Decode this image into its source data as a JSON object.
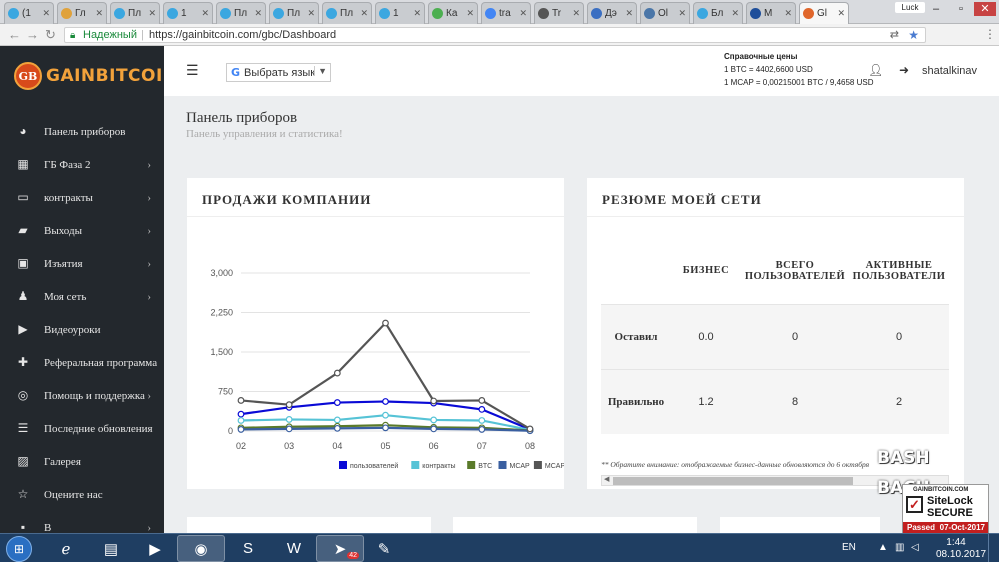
{
  "browser": {
    "tabs": [
      {
        "label": "(1",
        "color": "#3ba7e0"
      },
      {
        "label": "Гл",
        "color": "#e0a23b"
      },
      {
        "label": "Пл",
        "color": "#3ba7e0"
      },
      {
        "label": "1",
        "color": "#3ba7e0"
      },
      {
        "label": "Пл",
        "color": "#3ba7e0"
      },
      {
        "label": "Пл",
        "color": "#3ba7e0"
      },
      {
        "label": "Пл",
        "color": "#3ba7e0"
      },
      {
        "label": "1",
        "color": "#3ba7e0"
      },
      {
        "label": "Ка",
        "color": "#4caf50"
      },
      {
        "label": "tra",
        "color": "#4285f4"
      },
      {
        "label": "Tr",
        "color": "#555555"
      },
      {
        "label": "Дэ",
        "color": "#3b6fc2"
      },
      {
        "label": "Ol",
        "color": "#4a76a8"
      },
      {
        "label": "Бл",
        "color": "#3ba7e0"
      },
      {
        "label": "M",
        "color": "#1e4e9a"
      },
      {
        "label": "Gl",
        "color": "#e0662b"
      }
    ],
    "window_user": "Luck",
    "secure_label": "Надежный",
    "url": "https://gainbitcoin.com/gbc/Dashboard"
  },
  "sidebar": {
    "logo_badge": "GB",
    "logo_text": "GAINBITCOIN",
    "items": [
      {
        "label": "Панель приборов",
        "icon": "dashboard-icon",
        "glyph": "◕",
        "chevron": false
      },
      {
        "label": "ГБ Фаза 2",
        "icon": "grid-icon",
        "glyph": "▦",
        "chevron": true
      },
      {
        "label": "контракты",
        "icon": "contract-icon",
        "glyph": "▭",
        "chevron": true
      },
      {
        "label": "Выходы",
        "icon": "briefcase-icon",
        "glyph": "▰",
        "chevron": true
      },
      {
        "label": "Изъятия",
        "icon": "money-icon",
        "glyph": "▣",
        "chevron": true
      },
      {
        "label": "Моя сеть",
        "icon": "users-icon",
        "glyph": "♟",
        "chevron": true
      },
      {
        "label": "Видеоуроки",
        "icon": "play-circle-icon",
        "glyph": "▶",
        "chevron": false
      },
      {
        "label": "Реферальная программа",
        "icon": "user-plus-icon",
        "glyph": "✚",
        "chevron": false
      },
      {
        "label": "Помощь и поддержка",
        "icon": "support-icon",
        "glyph": "◎",
        "chevron": true
      },
      {
        "label": "Последние обновления",
        "icon": "list-icon",
        "glyph": "☰",
        "chevron": false
      },
      {
        "label": "Галерея",
        "icon": "image-icon",
        "glyph": "▨",
        "chevron": false
      },
      {
        "label": "Оцените нас",
        "icon": "star-icon",
        "glyph": "☆",
        "chevron": false
      },
      {
        "label": "В",
        "icon": "more-icon",
        "glyph": "▪",
        "chevron": true
      }
    ]
  },
  "header": {
    "language_select": "Выбрать язык",
    "prices_title": "Справочные цены",
    "price_btc": "1 BTC = 4402,6600 USD",
    "price_mcap": "1 MCAP = 0,00215001 BTC / 9,4658 USD",
    "username": "shatalkinav"
  },
  "page": {
    "title": "Панель приборов",
    "subtitle": "Панель управления и статистика!"
  },
  "sales": {
    "title": "ПРОДАЖИ КОМПАНИИ"
  },
  "chart_data": {
    "type": "line",
    "title": "ПРОДАЖИ КОМПАНИИ",
    "xlabel": "",
    "ylabel": "",
    "categories": [
      "02",
      "03",
      "04",
      "05",
      "06",
      "07",
      "08"
    ],
    "y_ticks": [
      "0",
      "750",
      "1,500",
      "2,250",
      "3,000"
    ],
    "ylim": [
      0,
      3000
    ],
    "grid": true,
    "legend_position": "bottom-right",
    "series": [
      {
        "name": "пользователей",
        "color": "#0a0ad6",
        "values": [
          320,
          450,
          540,
          560,
          530,
          410,
          30
        ]
      },
      {
        "name": "контракты",
        "color": "#56c3d6",
        "values": [
          200,
          220,
          210,
          300,
          210,
          200,
          20
        ]
      },
      {
        "name": "BTC",
        "color": "#5a7a2a",
        "values": [
          60,
          80,
          90,
          110,
          70,
          60,
          10
        ]
      },
      {
        "name": "MCAP",
        "color": "#3a5fa0",
        "values": [
          30,
          40,
          50,
          60,
          40,
          30,
          5
        ]
      },
      {
        "name": "MCAP-ETH",
        "color": "#555555",
        "values": [
          580,
          500,
          1100,
          2050,
          570,
          580,
          40
        ]
      }
    ]
  },
  "network": {
    "title": "РЕЗЮМЕ МОЕЙ СЕТИ",
    "columns": [
      "",
      "БИЗНЕС",
      "ВСЕГО ПОЛЬЗОВАТЕЛЕЙ",
      "АКТИВНЫЕ ПОЛЬЗОВАТЕЛИ"
    ],
    "rows": [
      {
        "label": "Оставил",
        "business": "0.0",
        "total": "0",
        "active": "0"
      },
      {
        "label": "Правильно",
        "business": "1.2",
        "total": "8",
        "active": "2"
      }
    ],
    "note": "** Обратите внимание: отображаемые бизнес-данные обновляются до 6 октября"
  },
  "badge": {
    "bash_line1": "BASH",
    "bash_line2": "BACH",
    "domain": "GAINBITCOIN.COM",
    "brand": "SiteLock",
    "secure": "SECURE",
    "passed": "Passed",
    "date": "07-Oct-2017"
  },
  "taskbar": {
    "language": "EN",
    "telegram_count": "42",
    "time": "1:44",
    "date": "08.10.2017"
  }
}
